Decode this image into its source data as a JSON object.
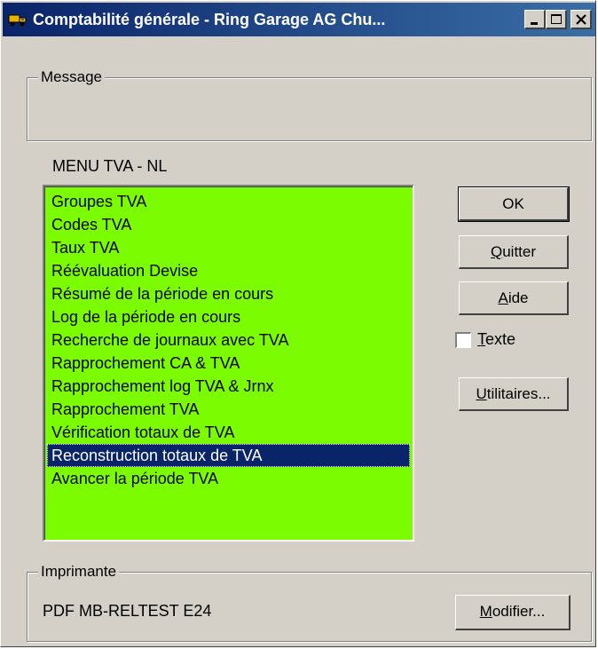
{
  "window": {
    "title": "Comptabilité générale - Ring Garage AG Chu...",
    "controls": [
      "minimize-icon",
      "maximize-icon",
      "close-icon"
    ]
  },
  "message_group": {
    "label": "Message",
    "text": ""
  },
  "menu": {
    "title": "MENU TVA - NL",
    "background_color": "#7cfc00",
    "selected_color": "#0a246a",
    "items": [
      "Groupes TVA",
      "Codes TVA",
      "Taux TVA",
      "Réévaluation Devise",
      "Résumé de la période en cours",
      "Log de la période en cours",
      "Recherche de journaux avec TVA",
      "Rapprochement CA & TVA",
      "Rapprochement log TVA & Jrnx",
      "Rapprochement TVA",
      "Vérification totaux de TVA",
      "Reconstruction totaux de TVA",
      "Avancer la période TVA"
    ],
    "selected_item": "Reconstruction totaux de TVA"
  },
  "buttons": {
    "ok": "OK",
    "quit": {
      "mnemonic": "Q",
      "rest": "uitter"
    },
    "help": {
      "mnemonic": "A",
      "rest": "ide"
    },
    "utilities": {
      "mnemonic": "U",
      "rest": "tilitaires..."
    },
    "modify": {
      "mnemonic": "M",
      "rest": "odifier..."
    }
  },
  "text_checkbox": {
    "mnemonic": "T",
    "rest": "exte",
    "checked": false
  },
  "printer_group": {
    "label": "Imprimante",
    "printer_name": "PDF MB-RELTEST E24"
  }
}
